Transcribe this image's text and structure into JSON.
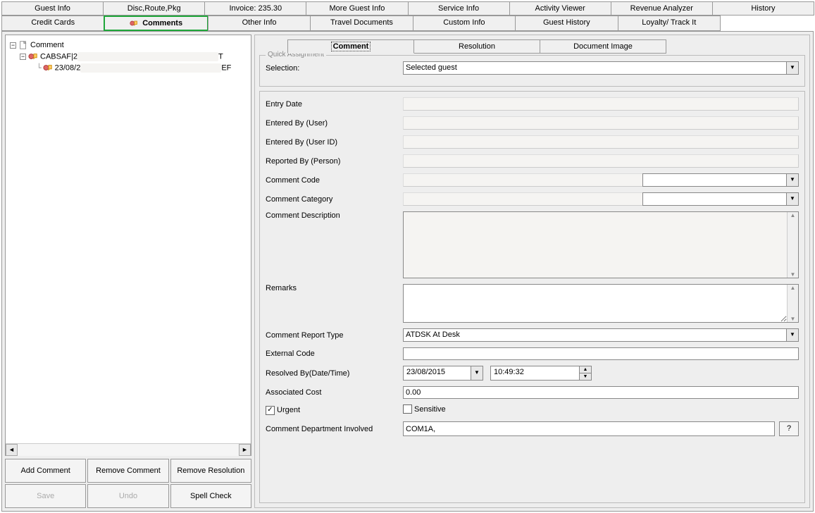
{
  "topTabs1": [
    {
      "label": "Guest Info"
    },
    {
      "label": "Disc,Route,Pkg"
    },
    {
      "label": "Invoice: 235.30"
    },
    {
      "label": "More Guest Info"
    },
    {
      "label": "Service Info"
    },
    {
      "label": "Activity Viewer"
    },
    {
      "label": "Revenue Analyzer"
    },
    {
      "label": "History"
    }
  ],
  "topTabs2": [
    {
      "label": "Credit Cards"
    },
    {
      "label": "Comments",
      "highlighted": true
    },
    {
      "label": "Other Info"
    },
    {
      "label": "Travel Documents"
    },
    {
      "label": "Custom Info"
    },
    {
      "label": "Guest History"
    },
    {
      "label": "Loyalty/ Track It"
    }
  ],
  "tree": {
    "root": "Comment",
    "node1_prefix": "CABSAF|2",
    "node1_suffix": "T",
    "node2_prefix": "23/08/2",
    "node2_suffix": "EF"
  },
  "buttons": {
    "addComment": "Add Comment",
    "removeComment": "Remove Comment",
    "removeResolution": "Remove Resolution",
    "save": "Save",
    "undo": "Undo",
    "spellCheck": "Spell Check"
  },
  "subTabs": [
    {
      "label": "Comment",
      "active": true
    },
    {
      "label": "Resolution"
    },
    {
      "label": "Document Image"
    }
  ],
  "quickAssignment": {
    "legend": "Quick Assignment",
    "selectionLabel": "Selection:",
    "selectionValue": "Selected guest"
  },
  "form": {
    "entryDate": {
      "label": "Entry Date"
    },
    "enteredByUser": {
      "label": "Entered By (User)"
    },
    "enteredByUserId": {
      "label": "Entered By (User ID)"
    },
    "reportedBy": {
      "label": "Reported By (Person)"
    },
    "commentCode": {
      "label": "Comment Code"
    },
    "commentCategory": {
      "label": "Comment Category"
    },
    "commentDescription": {
      "label": "Comment Description"
    },
    "remarks": {
      "label": "Remarks"
    },
    "commentReportType": {
      "label": "Comment Report Type",
      "value": "ATDSK At Desk"
    },
    "externalCode": {
      "label": "External Code",
      "value": ""
    },
    "resolvedBy": {
      "label": "Resolved By(Date/Time)",
      "date": "23/08/2015",
      "time": "10:49:32"
    },
    "associatedCost": {
      "label": "Associated Cost",
      "value": "0.00"
    },
    "urgent": {
      "label": "Urgent",
      "checked": true
    },
    "sensitive": {
      "label": "Sensitive",
      "checked": false
    },
    "department": {
      "label": "Comment Department Involved",
      "value": "COM1A,"
    },
    "helpBtn": "?"
  }
}
